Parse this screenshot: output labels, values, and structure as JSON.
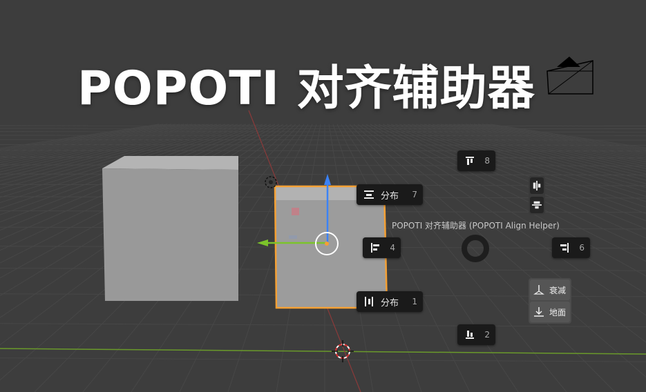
{
  "title": "POPOTI 对齐辅助器",
  "pie_menu": {
    "title": "POPOTI 对齐辅助器 (POPOTI Align Helper)",
    "items": {
      "top_align": {
        "label": "",
        "key": "8"
      },
      "distribute_horizontal": {
        "label": "分布",
        "key": "7"
      },
      "left_align": {
        "label": "",
        "key": "4"
      },
      "right_align": {
        "label": "",
        "key": "6"
      },
      "distribute_vertical": {
        "label": "分布",
        "key": "1"
      },
      "bottom_align": {
        "label": "",
        "key": "2"
      }
    },
    "center_align_buttons": [
      "align-center-vertical-icon",
      "align-center-horizontal-icon"
    ],
    "falloff_button": {
      "label": "衰减"
    },
    "ground_button": {
      "label": "地面"
    }
  },
  "colors": {
    "viewport_bg": "#3d3d3d",
    "grid_line": "#474747",
    "x_axis": "#8b3a3a",
    "y_axis": "#6a9a2a",
    "selection_outline": "#f5a033",
    "cube_face": "#9a9a9a",
    "menu_bg": "#1a1a1a"
  }
}
